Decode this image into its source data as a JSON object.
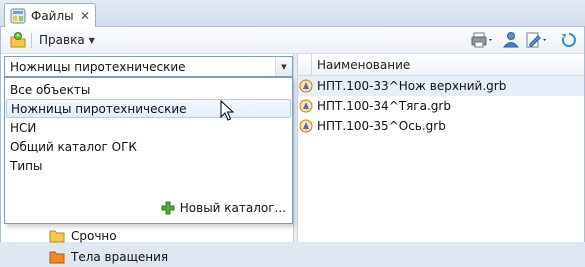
{
  "tab": {
    "title": "Файлы",
    "icon": "files-window-icon",
    "close_icon": "close-icon",
    "close_glyph": "✕"
  },
  "toolbar": {
    "menu_label": "Правка",
    "menu_caret": "▼",
    "icons": [
      "refresh-folder-icon",
      "print-icon",
      "user-icon",
      "edit-document-icon",
      "sync-icon"
    ]
  },
  "catalog": {
    "selected": "Ножницы пиротехнические",
    "caret": "▼",
    "options": [
      "Все объекты",
      "Ножницы пиротехнические",
      "НСИ",
      "Общий каталог ОГК",
      "Типы"
    ],
    "hover_index": 1,
    "new_catalog_label": "Новый каталог..."
  },
  "tree": {
    "items": [
      {
        "label": "Срочно",
        "icon": "folder-yellow-icon",
        "color": "#f2c14a"
      },
      {
        "label": "Тела вращения",
        "icon": "folder-orange-icon",
        "color": "#f08a24"
      }
    ]
  },
  "grid": {
    "column_name": "Наименование",
    "rows": [
      {
        "name": "НПТ.100-33^Нож верхний.grb",
        "selected": true
      },
      {
        "name": "НПТ.100-34^Тяга.grb",
        "selected": false
      },
      {
        "name": "НПТ.100-35^Ось.grb",
        "selected": false
      }
    ]
  }
}
